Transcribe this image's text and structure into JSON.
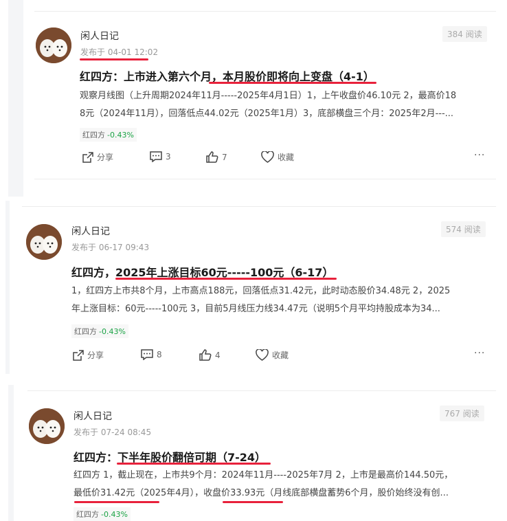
{
  "colors": {
    "underline": "#e8213b",
    "stock_change": "#1ba345"
  },
  "posts": [
    {
      "author": "闲人日记",
      "published": "发布于 04-01 12:02",
      "reads": "384 阅读",
      "title": "红四方：上市进入第六个月，本月股价即将向上变盘（4-1）",
      "excerpt_line1": "观察月线图（上升周期2024年11月-----2025年4月1日）1，上午收盘价46.10元 2，最高价18",
      "excerpt_line2": "8元（2024年11月），回落低点44.02元（2025年1月）3，底部横盘三个月：2025年2月---...",
      "stock_name": "红四方",
      "stock_change": "-0.43%",
      "share_label": "分享",
      "comments": "3",
      "likes": "7",
      "favorite_label": "收藏",
      "more": "···"
    },
    {
      "author": "闲人日记",
      "published": "发布于 06-17 09:43",
      "reads": "574 阅读",
      "title": "红四方，2025年上涨目标60元-----100元（6-17）",
      "excerpt_line1": "1，红四方上市共8个月，上市高点188元，回落低点31.42元，此时动态股价34.48元 2，2025",
      "excerpt_line2": "年上涨目标：60元-----100元 3，目前5月线压力线34.47元（说明5个月平均持股成本为34...",
      "stock_name": "红四方",
      "stock_change": "-0.43%",
      "share_label": "分享",
      "comments": "8",
      "likes": "4",
      "favorite_label": "收藏",
      "more": "···"
    },
    {
      "author": "闲人日记",
      "published": "发布于 07-24 08:45",
      "reads": "767 阅读",
      "title": "红四方：下半年股价翻倍可期（7-24）",
      "excerpt_line1": "红四方 1，截止现在，上市共9个月：2024年11月----2025年7月 2，上市是最高价144.50元，",
      "excerpt_line2": "最低价31.42元（2025年4月），收盘价33.93元（月线底部横盘蓄势6个月，股价始终没有创...",
      "stock_name": "红四方",
      "stock_change": "-0.43%"
    }
  ]
}
